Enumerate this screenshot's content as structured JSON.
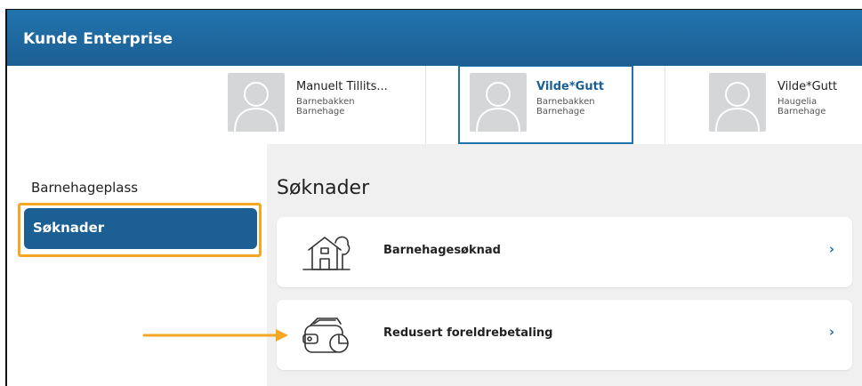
{
  "app": {
    "title": "Kunde Enterprise",
    "header_color": "#1b5f93"
  },
  "children": [
    {
      "name": "Manuelt Tillits...",
      "line1": "Barnebakken",
      "line2": "Barnehage",
      "selected": false,
      "avatar_icon": "person-placeholder-icon"
    },
    {
      "name": "Vilde*Gutt",
      "line1": "Barnebakken",
      "line2": "Barnehage",
      "selected": true,
      "avatar_icon": "person-placeholder-icon"
    },
    {
      "name": "Vilde*Gutt",
      "line1": "Haugelia",
      "line2": "Barnehage",
      "selected": false,
      "avatar_icon": "person-placeholder-icon"
    }
  ],
  "sidebar": {
    "items": [
      {
        "label": "Barnehageplass",
        "active": false
      },
      {
        "label": "Søknader",
        "active": true
      }
    ]
  },
  "main": {
    "title": "Søknader",
    "cards": [
      {
        "label": "Barnehagesøknad",
        "icon": "kindergarten-house-icon",
        "chevron": "›"
      },
      {
        "label": "Redusert foreldrebetaling",
        "icon": "wallet-pie-chart-icon",
        "chevron": "›"
      }
    ]
  },
  "annotation": {
    "highlight_color": "#f5a623"
  }
}
